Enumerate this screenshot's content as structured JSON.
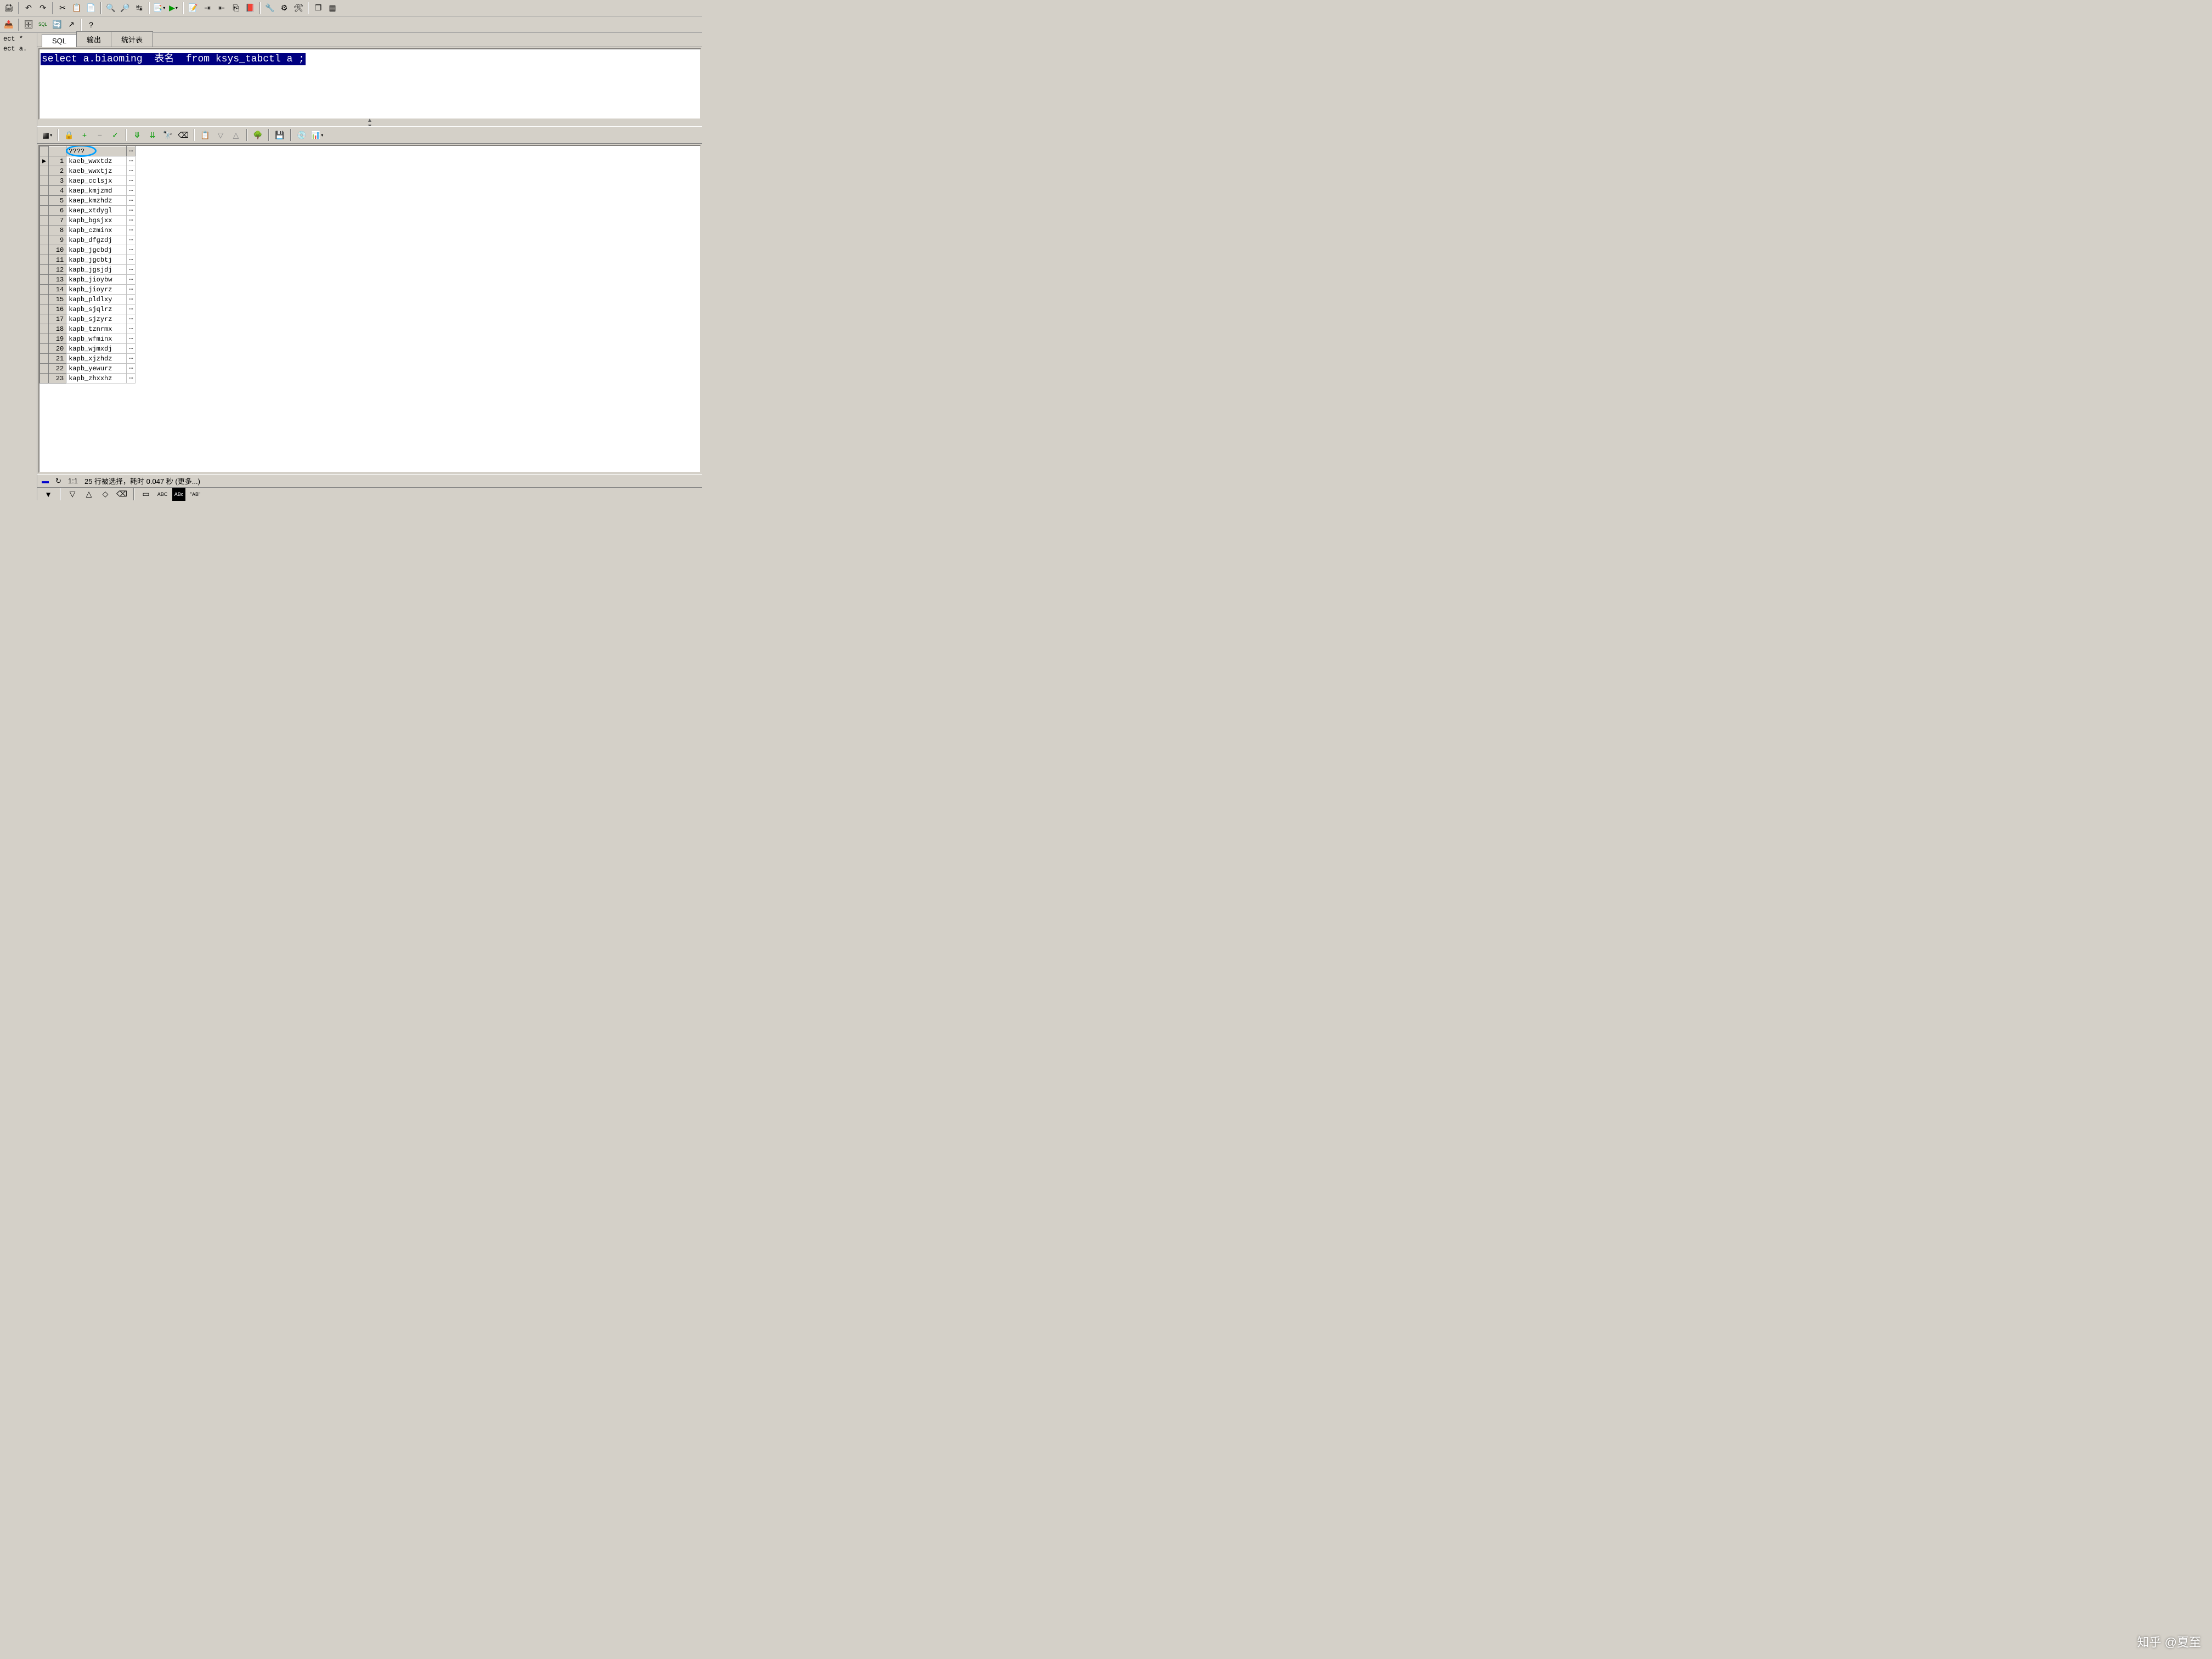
{
  "toolbar1": {
    "icons": [
      "print-icon",
      "undo-icon",
      "redo-icon",
      "cut-icon",
      "copy-icon",
      "paste-icon",
      "find-icon",
      "find-next-icon",
      "replace-icon",
      "doc-arrow-icon",
      "doc-green-icon",
      "exec-icon",
      "indent-icon",
      "outdent-icon",
      "toggle-icon",
      "doc-red-icon",
      "tool1-icon",
      "tool2-icon",
      "tool3-icon",
      "windows-icon",
      "grid-icon"
    ]
  },
  "toolbar2": {
    "icons": [
      "export-icon",
      "db-gear-icon",
      "sql-label-icon",
      "db-refresh-icon",
      "db-arrow-icon",
      "help-icon"
    ],
    "help_label": "?"
  },
  "left_panel": {
    "items": [
      "ect *",
      "ect a."
    ]
  },
  "tabs": {
    "items": [
      "SQL",
      "输出",
      "统计表"
    ],
    "active_index": 0
  },
  "sql": {
    "query": "select a.biaoming  表名  from ksys_tabctl a ;"
  },
  "result_toolbar": {
    "icons": [
      "grid-opt-icon",
      "lock-icon",
      "plus-icon",
      "minus-icon",
      "check-icon",
      "fetch-down-icon",
      "fetch-all-icon",
      "binoculars-icon",
      "eraser-icon",
      "copy-grid-icon",
      "filter-down-icon",
      "filter-up-icon",
      "tree-icon",
      "save-icon",
      "disk-blue-icon",
      "chart-icon"
    ]
  },
  "grid": {
    "column_header": "????",
    "rows": [
      {
        "n": 1,
        "v": "kaeb_wwxtdz",
        "current": true
      },
      {
        "n": 2,
        "v": "kaeb_wwxtjz"
      },
      {
        "n": 3,
        "v": "kaep_cclsjx"
      },
      {
        "n": 4,
        "v": "kaep_kmjzmd"
      },
      {
        "n": 5,
        "v": "kaep_kmzhdz"
      },
      {
        "n": 6,
        "v": "kaep_xtdygl"
      },
      {
        "n": 7,
        "v": "kapb_bgsjxx"
      },
      {
        "n": 8,
        "v": "kapb_czminx"
      },
      {
        "n": 9,
        "v": "kapb_dfgzdj"
      },
      {
        "n": 10,
        "v": "kapb_jgcbdj"
      },
      {
        "n": 11,
        "v": "kapb_jgcbtj"
      },
      {
        "n": 12,
        "v": "kapb_jgsjdj"
      },
      {
        "n": 13,
        "v": "kapb_jioybw"
      },
      {
        "n": 14,
        "v": "kapb_jioyrz"
      },
      {
        "n": 15,
        "v": "kapb_pldlxy"
      },
      {
        "n": 16,
        "v": "kapb_sjqlrz"
      },
      {
        "n": 17,
        "v": "kapb_sjzyrz"
      },
      {
        "n": 18,
        "v": "kapb_tznrmx"
      },
      {
        "n": 19,
        "v": "kapb_wfminx"
      },
      {
        "n": 20,
        "v": "kapb_wjmxdj"
      },
      {
        "n": 21,
        "v": "kapb_xjzhdz"
      },
      {
        "n": 22,
        "v": "kapb_yewurz"
      },
      {
        "n": 23,
        "v": "kapb_zhxxhz"
      }
    ]
  },
  "status": {
    "pos": "1:1",
    "message": "25 行被选择，耗时 0.047 秒 (更多...)"
  },
  "bottom_bar": {
    "items": [
      "▼",
      "▽",
      "△",
      "◇",
      "⌫",
      "▭",
      "ABC",
      "ABc",
      "\"AB\""
    ]
  },
  "watermark": "知乎 @夏至"
}
